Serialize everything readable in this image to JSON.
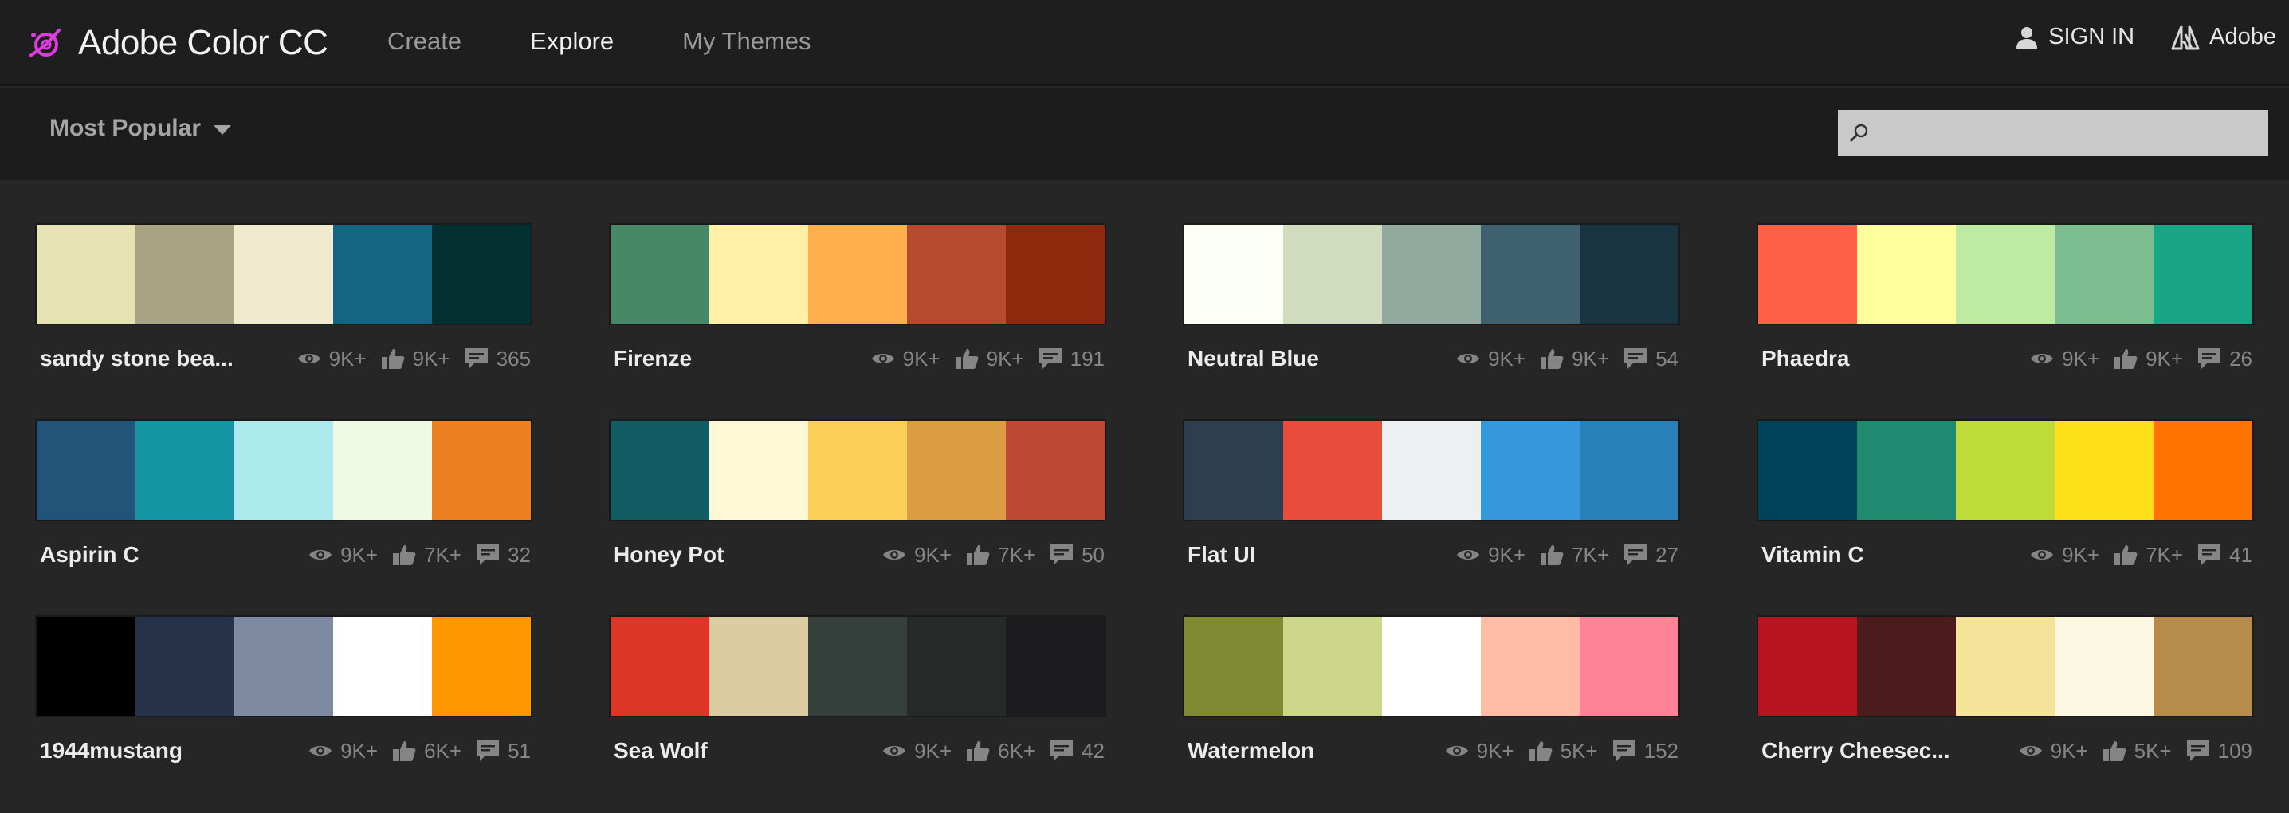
{
  "app": {
    "title": "Adobe Color CC",
    "nav": [
      "Create",
      "Explore",
      "My Themes"
    ],
    "active_nav": "Explore",
    "sign_in": "SIGN IN",
    "adobe": "Adobe",
    "brand_color": "#da3ddc"
  },
  "filter": {
    "sort_label": "Most Popular",
    "search_placeholder": "",
    "search_value": ""
  },
  "themes": [
    {
      "name": "sandy stone bea...",
      "views": "9K+",
      "likes": "9K+",
      "comments": "365",
      "colors": [
        "#e6e2b4",
        "#a8a383",
        "#f0eace",
        "#136582",
        "#033131"
      ]
    },
    {
      "name": "Firenze",
      "views": "9K+",
      "likes": "9K+",
      "comments": "191",
      "colors": [
        "#478966",
        "#fff0a5",
        "#ffb04a",
        "#b74a2e",
        "#8d2a0e"
      ]
    },
    {
      "name": "Neutral Blue",
      "views": "9K+",
      "likes": "9K+",
      "comments": "54",
      "colors": [
        "#fcfff5",
        "#d1dbbd",
        "#91aa9d",
        "#3e606f",
        "#193441"
      ]
    },
    {
      "name": "Phaedra",
      "views": "9K+",
      "likes": "9K+",
      "comments": "26",
      "colors": [
        "#ff6147",
        "#ffff9e",
        "#bfeaa2",
        "#7cbd90",
        "#19a687"
      ]
    },
    {
      "name": "Aspirin C",
      "views": "9K+",
      "likes": "7K+",
      "comments": "32",
      "colors": [
        "#225378",
        "#1595a3",
        "#ace9ec",
        "#eff8e1",
        "#eb7f22"
      ]
    },
    {
      "name": "Honey Pot",
      "views": "9K+",
      "likes": "7K+",
      "comments": "50",
      "colors": [
        "#125c64",
        "#fff8d7",
        "#fcd057",
        "#dc9c42",
        "#be4a35"
      ]
    },
    {
      "name": "Flat UI",
      "views": "9K+",
      "likes": "7K+",
      "comments": "27",
      "colors": [
        "#2c3e50",
        "#e74c3c",
        "#ecf0f1",
        "#3498db",
        "#2980b9"
      ]
    },
    {
      "name": "Vitamin C",
      "views": "9K+",
      "likes": "7K+",
      "comments": "41",
      "colors": [
        "#004358",
        "#1f8a70",
        "#bedb39",
        "#ffe11a",
        "#fd7400"
      ]
    },
    {
      "name": "1944mustang",
      "views": "9K+",
      "likes": "6K+",
      "comments": "51",
      "colors": [
        "#000000",
        "#263249",
        "#7e8aa2",
        "#ffffff",
        "#ff9800"
      ]
    },
    {
      "name": "Sea Wolf",
      "views": "9K+",
      "likes": "6K+",
      "comments": "42",
      "colors": [
        "#dc3629",
        "#dbcca2",
        "#353f3c",
        "#262a29",
        "#1c1c1e"
      ]
    },
    {
      "name": "Watermelon",
      "views": "9K+",
      "likes": "5K+",
      "comments": "152",
      "colors": [
        "#7f8a33",
        "#ccd78c",
        "#ffffff",
        "#ffbca6",
        "#ff8397"
      ]
    },
    {
      "name": "Cherry Cheesec...",
      "views": "9K+",
      "likes": "5K+",
      "comments": "109",
      "colors": [
        "#b8141f",
        "#4c1b1b",
        "#f5e39a",
        "#fcf8e1",
        "#b78b4c"
      ]
    }
  ]
}
